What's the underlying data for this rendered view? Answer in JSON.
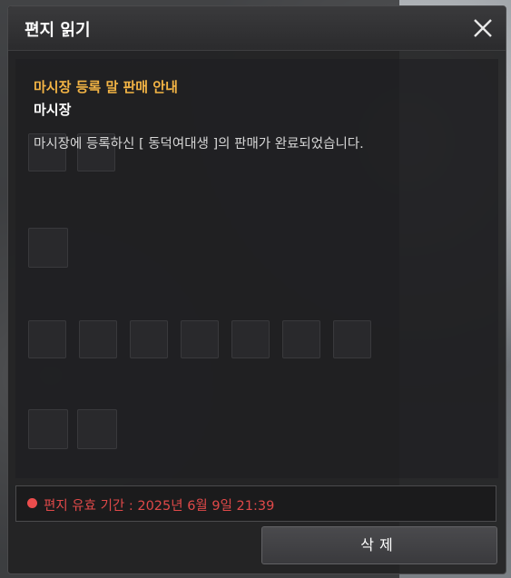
{
  "window": {
    "title": "편지 읽기",
    "close_icon": "close-icon"
  },
  "mail": {
    "subject": "마시장 등록 말 판매 안내",
    "sender": "마시장",
    "body": "마시장에 등록하신 [ 동덕여대생 ]의 판매가 완료되었습니다."
  },
  "expiry": {
    "text": "편지 유효 기간 : 2025년 6월 9일 21:39",
    "color": "#e04949"
  },
  "actions": {
    "delete_label": "삭제"
  },
  "colors": {
    "subject": "#f3b445",
    "expiry_dot": "#ec4d4d"
  }
}
